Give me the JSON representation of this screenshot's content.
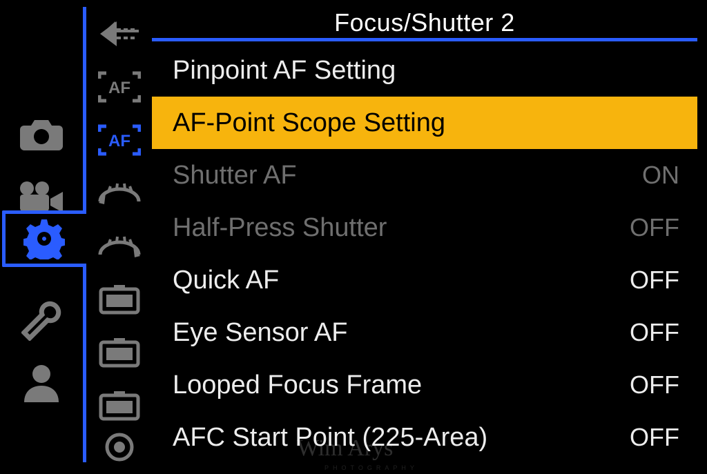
{
  "title": "Focus/Shutter 2",
  "colors": {
    "accent": "#2a5cff",
    "highlight": "#f7b40d",
    "dim": "#6f6f6f",
    "text": "#ededed"
  },
  "leftTabs": [
    {
      "icon": "camera-icon",
      "selected": false
    },
    {
      "icon": "video-icon",
      "selected": false
    },
    {
      "icon": "gear-icon",
      "selected": true
    },
    {
      "icon": "wrench-icon",
      "selected": false
    },
    {
      "icon": "user-icon",
      "selected": false
    }
  ],
  "subTabs": [
    {
      "icon": "back-icon",
      "selected": false
    },
    {
      "icon": "af-gray-icon",
      "selected": false
    },
    {
      "icon": "af-blue-icon",
      "selected": true
    },
    {
      "icon": "dial-back-icon",
      "selected": false
    },
    {
      "icon": "dial-forward-icon",
      "selected": false
    },
    {
      "icon": "lcd1-icon",
      "selected": false
    },
    {
      "icon": "lcd2-icon",
      "selected": false
    },
    {
      "icon": "lcd3-icon",
      "selected": false
    },
    {
      "icon": "lens-icon",
      "selected": false
    }
  ],
  "rows": [
    {
      "label": "Pinpoint AF Setting",
      "value": "",
      "state": "normal"
    },
    {
      "label": "AF-Point Scope Setting",
      "value": "",
      "state": "selected"
    },
    {
      "label": "Shutter AF",
      "value": "ON",
      "state": "disabled"
    },
    {
      "label": "Half-Press Shutter",
      "value": "OFF",
      "state": "disabled"
    },
    {
      "label": "Quick AF",
      "value": "OFF",
      "state": "normal"
    },
    {
      "label": "Eye Sensor AF",
      "value": "OFF",
      "state": "normal"
    },
    {
      "label": "Looped Focus Frame",
      "value": "OFF",
      "state": "normal"
    },
    {
      "label": "AFC Start Point (225-Area)",
      "value": "OFF",
      "state": "normal"
    }
  ],
  "watermark": {
    "script": "Wim Arys",
    "sub": "PHOTOGRAPHY"
  }
}
